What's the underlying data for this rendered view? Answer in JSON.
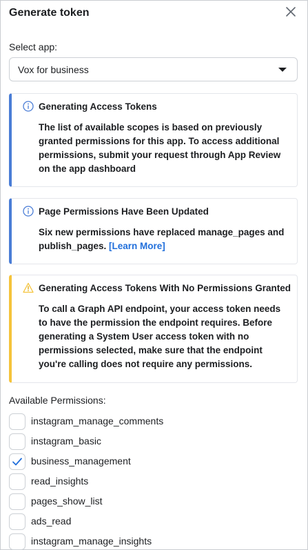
{
  "dialog": {
    "title": "Generate token"
  },
  "select_app": {
    "label": "Select app:",
    "value": "Vox for business"
  },
  "notices": [
    {
      "type": "info",
      "title": "Generating Access Tokens",
      "body": "The list of available scopes is based on previously granted permissions for this app. To access additional permissions, submit your request through App Review on the app dashboard"
    },
    {
      "type": "info",
      "title": "Page Permissions Have Been Updated",
      "body": "Six new permissions have replaced manage_pages and publish_pages.",
      "link": "[Learn More]"
    },
    {
      "type": "warning",
      "title": "Generating Access Tokens With No Permissions Granted",
      "body": "To call a Graph API endpoint, your access token needs to have the permission the endpoint requires. Before generating a System User access token with no permissions selected, make sure that the endpoint you're calling does not require any permissions."
    }
  ],
  "permissions": {
    "label": "Available Permissions:",
    "items": [
      {
        "name": "instagram_manage_comments",
        "checked": false
      },
      {
        "name": "instagram_basic",
        "checked": false
      },
      {
        "name": "business_management",
        "checked": true
      },
      {
        "name": "read_insights",
        "checked": false
      },
      {
        "name": "pages_show_list",
        "checked": false
      },
      {
        "name": "ads_read",
        "checked": false
      },
      {
        "name": "instagram_manage_insights",
        "checked": false
      }
    ]
  },
  "colors": {
    "info_accent": "#4a7dd6",
    "warning_accent": "#f5c33b",
    "link": "#216fdb",
    "check": "#216fdb"
  },
  "icons": {
    "close": "close-icon",
    "info": "info-icon",
    "warning": "warning-icon",
    "dropdown": "caret-down-icon",
    "check": "checkmark-icon"
  }
}
